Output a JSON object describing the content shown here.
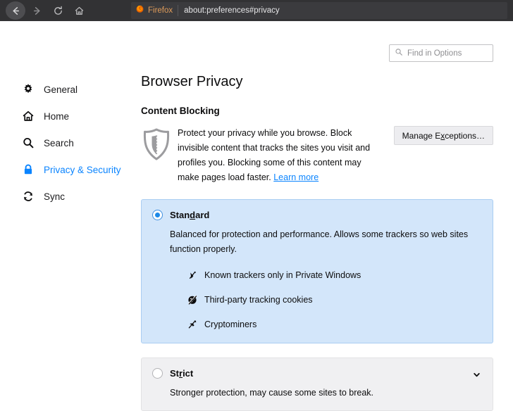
{
  "chrome": {
    "back_icon": "back-arrow-icon",
    "forward_icon": "forward-arrow-icon",
    "reload_icon": "reload-icon",
    "home_icon": "home-icon",
    "brand_label": "Firefox",
    "url": "about:preferences#privacy"
  },
  "search": {
    "placeholder": "Find in Options",
    "icon": "search-icon"
  },
  "sidebar": {
    "items": [
      {
        "label": "General",
        "icon": "gear-icon",
        "active": false
      },
      {
        "label": "Home",
        "icon": "home-icon",
        "active": false
      },
      {
        "label": "Search",
        "icon": "search-icon",
        "active": false
      },
      {
        "label": "Privacy & Security",
        "icon": "lock-icon",
        "active": true
      },
      {
        "label": "Sync",
        "icon": "sync-icon",
        "active": false
      }
    ]
  },
  "main": {
    "page_title": "Browser Privacy",
    "section_title": "Content Blocking",
    "shield_icon": "shield-icon",
    "description_line1": "Protect your privacy while you browse. Block invisible content",
    "description_line2": "that tracks the sites you visit and profiles you. Blocking some of",
    "description_line3": "this content may make pages load faster.",
    "learn_more": "Learn more",
    "manage_exceptions_pre": "Manage E",
    "manage_exceptions_acc": "x",
    "manage_exceptions_post": "ceptions…",
    "standard": {
      "title_pre": "Stan",
      "title_acc": "d",
      "title_post": "ard",
      "selected": true,
      "description": "Balanced for protection and performance. Allows some trackers so web sites function properly.",
      "features": [
        {
          "label": "Known trackers only in Private Windows",
          "icon": "tracker-blocked-icon"
        },
        {
          "label": "Third-party tracking cookies",
          "icon": "cookie-blocked-icon"
        },
        {
          "label": "Cryptominers",
          "icon": "cryptominer-blocked-icon"
        }
      ]
    },
    "strict": {
      "title_pre": "St",
      "title_acc": "r",
      "title_post": "ict",
      "selected": false,
      "description": "Stronger protection, may cause some sites to break.",
      "expander_icon": "chevron-down-icon"
    }
  },
  "colors": {
    "accent": "#0a84ff",
    "chrome_bg": "#323234",
    "brand_orange": "#e09c5a",
    "selected_panel_bg": "#d3e6fa",
    "plain_panel_bg": "#f0f0f2"
  }
}
